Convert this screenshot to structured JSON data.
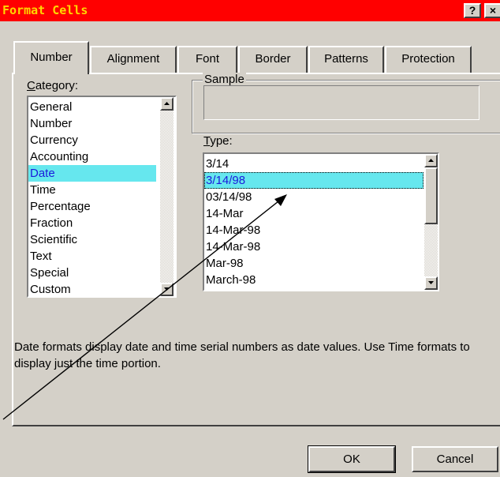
{
  "window": {
    "title": "Format Cells",
    "help_button": "?",
    "close_button": "×"
  },
  "tabs": [
    "Number",
    "Alignment",
    "Font",
    "Border",
    "Patterns",
    "Protection"
  ],
  "category": {
    "label": "Category:",
    "items": [
      "General",
      "Number",
      "Currency",
      "Accounting",
      "Date",
      "Time",
      "Percentage",
      "Fraction",
      "Scientific",
      "Text",
      "Special",
      "Custom"
    ],
    "selected": "Date"
  },
  "sample": {
    "label": "Sample",
    "value": ""
  },
  "type": {
    "label": "Type:",
    "items": [
      "3/14",
      "3/14/98",
      "03/14/98",
      "14-Mar",
      "14-Mar-98",
      "14-Mar-98",
      "Mar-98",
      "March-98"
    ],
    "selected": "3/14/98"
  },
  "description": "Date formats display date and time serial numbers as date values.  Use Time formats to display just the time portion.",
  "buttons": {
    "ok": "OK",
    "cancel": "Cancel"
  },
  "colors": {
    "titlebar": "#ff0000",
    "title_text": "#ffd700",
    "selection": "#66e7ee",
    "face": "#d4d0c8"
  }
}
